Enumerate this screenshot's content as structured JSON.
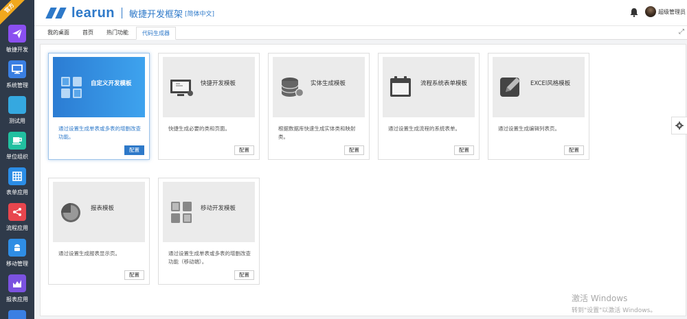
{
  "sidebar": {
    "badge": "官方",
    "items": [
      {
        "label": "敏捷开发",
        "color": "#8a4ff0",
        "icon": "send-icon"
      },
      {
        "label": "系统管理",
        "color": "#3a7fe3",
        "icon": "monitor-icon"
      },
      {
        "label": "测试用",
        "color": "#35a8e0",
        "icon": "blank-icon"
      },
      {
        "label": "单位组织",
        "color": "#22c0a0",
        "icon": "cup-icon"
      },
      {
        "label": "表单应用",
        "color": "#2b8de6",
        "icon": "grid-icon"
      },
      {
        "label": "流程应用",
        "color": "#e8464e",
        "icon": "share-icon"
      },
      {
        "label": "移动管理",
        "color": "#2f8de4",
        "icon": "android-icon"
      },
      {
        "label": "报表应用",
        "color": "#7b52e0",
        "icon": "chart-icon"
      }
    ]
  },
  "header": {
    "brand": "learun",
    "subtitle": "敏捷开发框架",
    "lang": "[简体中文]",
    "user": "超级管理员"
  },
  "tabs": [
    {
      "label": "我的桌面",
      "active": false
    },
    {
      "label": "首页",
      "active": false
    },
    {
      "label": "热门功能",
      "active": false
    },
    {
      "label": "代码生成器",
      "active": true
    }
  ],
  "templates": [
    {
      "name": "自定义开发模板",
      "desc": "通过设置生成单表或多表的增删改查功能。",
      "button": "配置",
      "icon": "squares-icon",
      "selected": true
    },
    {
      "name": "快捷开发模板",
      "desc": "快捷生成必要的类和页面。",
      "button": "配置",
      "icon": "monitor-icon",
      "selected": false
    },
    {
      "name": "实体生成模板",
      "desc": "根据数据库快速生成实体类和映射类。",
      "button": "配置",
      "icon": "database-icon",
      "selected": false
    },
    {
      "name": "流程系统表单模板",
      "desc": "通过设置生成流程的系统表单。",
      "button": "配置",
      "icon": "calendar-icon",
      "selected": false
    },
    {
      "name": "EXCEl风格模板",
      "desc": "通过设置生成编辑列表页。",
      "button": "配置",
      "icon": "edit-icon",
      "selected": false
    },
    {
      "name": "报表模板",
      "desc": "通过设置生成报表显示页。",
      "button": "配置",
      "icon": "pie-icon",
      "selected": false
    },
    {
      "name": "移动开发模板",
      "desc": "通过设置生成单表或多表的增删改查功能（移动端）。",
      "button": "配置",
      "icon": "grid-icon",
      "selected": false
    }
  ],
  "watermark": {
    "line1": "激活 Windows",
    "line2": "转到\"设置\"以激活 Windows。"
  },
  "colors": {
    "accent": "#2e79c9",
    "sidebar": "#2f3a4a"
  }
}
